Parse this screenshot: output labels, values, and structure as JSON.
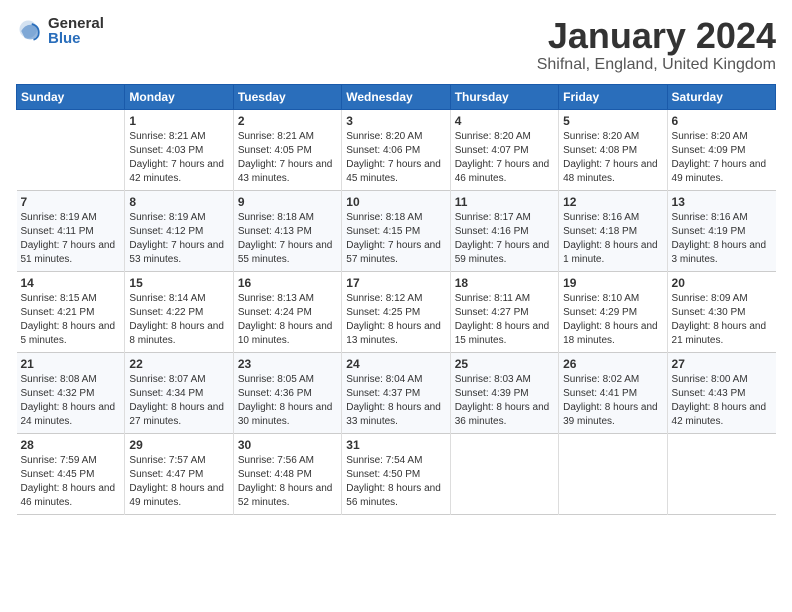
{
  "logo": {
    "general": "General",
    "blue": "Blue"
  },
  "title": "January 2024",
  "subtitle": "Shifnal, England, United Kingdom",
  "headers": [
    "Sunday",
    "Monday",
    "Tuesday",
    "Wednesday",
    "Thursday",
    "Friday",
    "Saturday"
  ],
  "weeks": [
    [
      {
        "day": "",
        "sunrise": "",
        "sunset": "",
        "daylight": ""
      },
      {
        "day": "1",
        "sunrise": "Sunrise: 8:21 AM",
        "sunset": "Sunset: 4:03 PM",
        "daylight": "Daylight: 7 hours and 42 minutes."
      },
      {
        "day": "2",
        "sunrise": "Sunrise: 8:21 AM",
        "sunset": "Sunset: 4:05 PM",
        "daylight": "Daylight: 7 hours and 43 minutes."
      },
      {
        "day": "3",
        "sunrise": "Sunrise: 8:20 AM",
        "sunset": "Sunset: 4:06 PM",
        "daylight": "Daylight: 7 hours and 45 minutes."
      },
      {
        "day": "4",
        "sunrise": "Sunrise: 8:20 AM",
        "sunset": "Sunset: 4:07 PM",
        "daylight": "Daylight: 7 hours and 46 minutes."
      },
      {
        "day": "5",
        "sunrise": "Sunrise: 8:20 AM",
        "sunset": "Sunset: 4:08 PM",
        "daylight": "Daylight: 7 hours and 48 minutes."
      },
      {
        "day": "6",
        "sunrise": "Sunrise: 8:20 AM",
        "sunset": "Sunset: 4:09 PM",
        "daylight": "Daylight: 7 hours and 49 minutes."
      }
    ],
    [
      {
        "day": "7",
        "sunrise": "Sunrise: 8:19 AM",
        "sunset": "Sunset: 4:11 PM",
        "daylight": "Daylight: 7 hours and 51 minutes."
      },
      {
        "day": "8",
        "sunrise": "Sunrise: 8:19 AM",
        "sunset": "Sunset: 4:12 PM",
        "daylight": "Daylight: 7 hours and 53 minutes."
      },
      {
        "day": "9",
        "sunrise": "Sunrise: 8:18 AM",
        "sunset": "Sunset: 4:13 PM",
        "daylight": "Daylight: 7 hours and 55 minutes."
      },
      {
        "day": "10",
        "sunrise": "Sunrise: 8:18 AM",
        "sunset": "Sunset: 4:15 PM",
        "daylight": "Daylight: 7 hours and 57 minutes."
      },
      {
        "day": "11",
        "sunrise": "Sunrise: 8:17 AM",
        "sunset": "Sunset: 4:16 PM",
        "daylight": "Daylight: 7 hours and 59 minutes."
      },
      {
        "day": "12",
        "sunrise": "Sunrise: 8:16 AM",
        "sunset": "Sunset: 4:18 PM",
        "daylight": "Daylight: 8 hours and 1 minute."
      },
      {
        "day": "13",
        "sunrise": "Sunrise: 8:16 AM",
        "sunset": "Sunset: 4:19 PM",
        "daylight": "Daylight: 8 hours and 3 minutes."
      }
    ],
    [
      {
        "day": "14",
        "sunrise": "Sunrise: 8:15 AM",
        "sunset": "Sunset: 4:21 PM",
        "daylight": "Daylight: 8 hours and 5 minutes."
      },
      {
        "day": "15",
        "sunrise": "Sunrise: 8:14 AM",
        "sunset": "Sunset: 4:22 PM",
        "daylight": "Daylight: 8 hours and 8 minutes."
      },
      {
        "day": "16",
        "sunrise": "Sunrise: 8:13 AM",
        "sunset": "Sunset: 4:24 PM",
        "daylight": "Daylight: 8 hours and 10 minutes."
      },
      {
        "day": "17",
        "sunrise": "Sunrise: 8:12 AM",
        "sunset": "Sunset: 4:25 PM",
        "daylight": "Daylight: 8 hours and 13 minutes."
      },
      {
        "day": "18",
        "sunrise": "Sunrise: 8:11 AM",
        "sunset": "Sunset: 4:27 PM",
        "daylight": "Daylight: 8 hours and 15 minutes."
      },
      {
        "day": "19",
        "sunrise": "Sunrise: 8:10 AM",
        "sunset": "Sunset: 4:29 PM",
        "daylight": "Daylight: 8 hours and 18 minutes."
      },
      {
        "day": "20",
        "sunrise": "Sunrise: 8:09 AM",
        "sunset": "Sunset: 4:30 PM",
        "daylight": "Daylight: 8 hours and 21 minutes."
      }
    ],
    [
      {
        "day": "21",
        "sunrise": "Sunrise: 8:08 AM",
        "sunset": "Sunset: 4:32 PM",
        "daylight": "Daylight: 8 hours and 24 minutes."
      },
      {
        "day": "22",
        "sunrise": "Sunrise: 8:07 AM",
        "sunset": "Sunset: 4:34 PM",
        "daylight": "Daylight: 8 hours and 27 minutes."
      },
      {
        "day": "23",
        "sunrise": "Sunrise: 8:05 AM",
        "sunset": "Sunset: 4:36 PM",
        "daylight": "Daylight: 8 hours and 30 minutes."
      },
      {
        "day": "24",
        "sunrise": "Sunrise: 8:04 AM",
        "sunset": "Sunset: 4:37 PM",
        "daylight": "Daylight: 8 hours and 33 minutes."
      },
      {
        "day": "25",
        "sunrise": "Sunrise: 8:03 AM",
        "sunset": "Sunset: 4:39 PM",
        "daylight": "Daylight: 8 hours and 36 minutes."
      },
      {
        "day": "26",
        "sunrise": "Sunrise: 8:02 AM",
        "sunset": "Sunset: 4:41 PM",
        "daylight": "Daylight: 8 hours and 39 minutes."
      },
      {
        "day": "27",
        "sunrise": "Sunrise: 8:00 AM",
        "sunset": "Sunset: 4:43 PM",
        "daylight": "Daylight: 8 hours and 42 minutes."
      }
    ],
    [
      {
        "day": "28",
        "sunrise": "Sunrise: 7:59 AM",
        "sunset": "Sunset: 4:45 PM",
        "daylight": "Daylight: 8 hours and 46 minutes."
      },
      {
        "day": "29",
        "sunrise": "Sunrise: 7:57 AM",
        "sunset": "Sunset: 4:47 PM",
        "daylight": "Daylight: 8 hours and 49 minutes."
      },
      {
        "day": "30",
        "sunrise": "Sunrise: 7:56 AM",
        "sunset": "Sunset: 4:48 PM",
        "daylight": "Daylight: 8 hours and 52 minutes."
      },
      {
        "day": "31",
        "sunrise": "Sunrise: 7:54 AM",
        "sunset": "Sunset: 4:50 PM",
        "daylight": "Daylight: 8 hours and 56 minutes."
      },
      {
        "day": "",
        "sunrise": "",
        "sunset": "",
        "daylight": ""
      },
      {
        "day": "",
        "sunrise": "",
        "sunset": "",
        "daylight": ""
      },
      {
        "day": "",
        "sunrise": "",
        "sunset": "",
        "daylight": ""
      }
    ]
  ]
}
